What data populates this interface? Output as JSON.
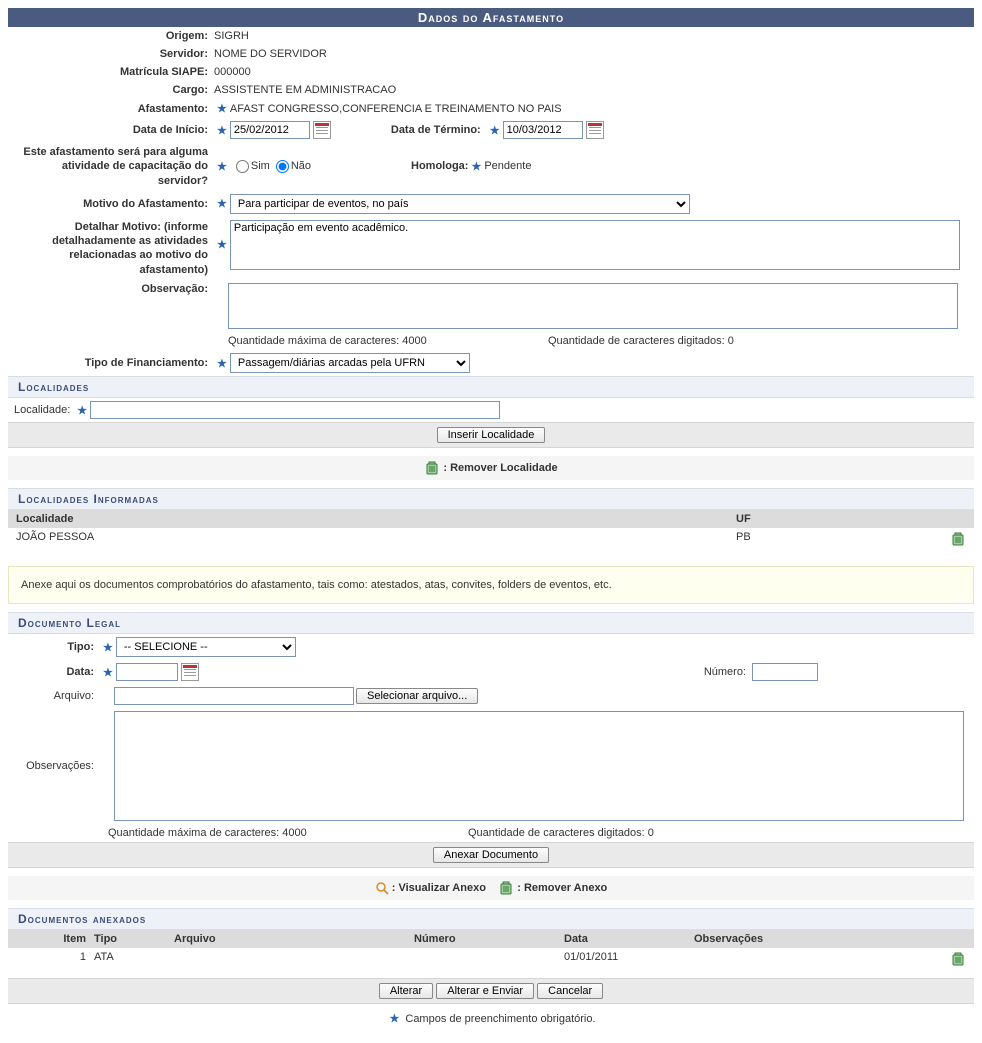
{
  "title": "Dados do Afastamento",
  "fields": {
    "origem_lbl": "Origem:",
    "origem_val": "SIGRH",
    "servidor_lbl": "Servidor:",
    "servidor_val": "NOME DO SERVIDOR",
    "matricula_lbl": "Matrícula SIAPE:",
    "matricula_val": "000000",
    "cargo_lbl": "Cargo:",
    "cargo_val": "ASSISTENTE EM ADMINISTRACAO",
    "afast_lbl": "Afastamento:",
    "afast_val": "AFAST CONGRESSO,CONFERENCIA E TREINAMENTO NO PAIS",
    "dini_lbl": "Data de Início:",
    "dini_val": "25/02/2012",
    "dfim_lbl": "Data de Término:",
    "dfim_val": "10/03/2012",
    "capac_lbl": "Este afastamento será para alguma atividade de capacitação do servidor?",
    "sim": "Sim",
    "nao": "Não",
    "homologa_lbl": "Homologa:",
    "homologa_val": "Pendente",
    "motivo_lbl": "Motivo do Afastamento:",
    "motivo_val": "Para participar de eventos, no país",
    "detalhar_lbl": "Detalhar Motivo: (informe detalhadamente as atividades relacionadas ao motivo do afastamento)",
    "detalhar_val": "Participação em evento acadêmico.",
    "obs_lbl": "Observação:",
    "maxchars": "Quantidade máxima de caracteres: 4000",
    "digitados": "Quantidade de caracteres digitados: 0",
    "financ_lbl": "Tipo de Financiamento:",
    "financ_val": "Passagem/diárias arcadas pela UFRN"
  },
  "localidades": {
    "header": "Localidades",
    "loc_lbl": "Localidade:",
    "btn_inserir": "Inserir Localidade",
    "legend_remover": ": Remover Localidade",
    "informadas_header": "Localidades Informadas",
    "col_loc": "Localidade",
    "col_uf": "UF",
    "row_loc": "JOÃO PESSOA",
    "row_uf": "PB"
  },
  "note": "Anexe aqui os documentos comprobatórios do afastamento, tais como: atestados, atas, convites, folders de eventos, etc.",
  "docLegal": {
    "header": "Documento Legal",
    "tipo_lbl": "Tipo:",
    "tipo_val": "-- SELECIONE --",
    "data_lbl": "Data:",
    "numero_lbl": "Número:",
    "arquivo_lbl": "Arquivo:",
    "selecionar": "Selecionar arquivo...",
    "obs_lbl": "Observações:",
    "btn_anexar": "Anexar Documento",
    "legend_visualizar": ": Visualizar Anexo",
    "legend_remover": ": Remover Anexo"
  },
  "anexados": {
    "header": "Documentos anexados",
    "col_item": "Item",
    "col_tipo": "Tipo",
    "col_arquivo": "Arquivo",
    "col_numero": "Número",
    "col_data": "Data",
    "col_obs": "Observações",
    "row_item": "1",
    "row_tipo": "ATA",
    "row_data": "01/01/2011"
  },
  "buttons": {
    "alterar": "Alterar",
    "alterar_enviar": "Alterar e Enviar",
    "cancelar": "Cancelar"
  },
  "footer": "Campos de preenchimento obrigatório."
}
